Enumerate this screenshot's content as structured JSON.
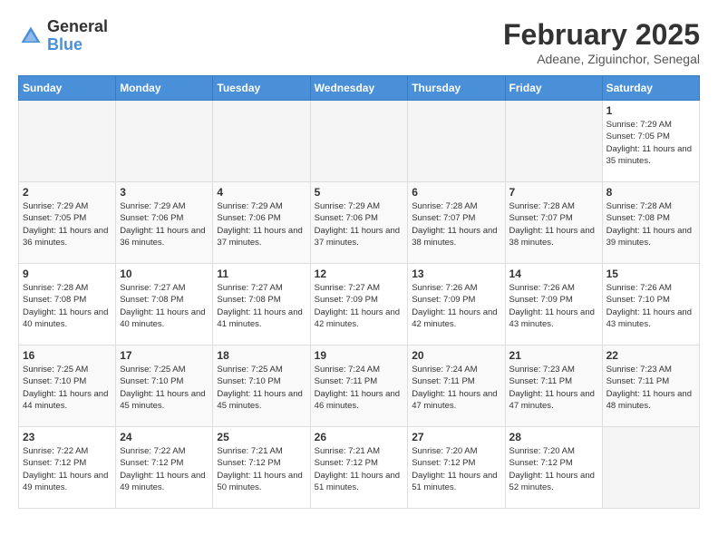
{
  "header": {
    "logo_general": "General",
    "logo_blue": "Blue",
    "month_title": "February 2025",
    "location": "Adeane, Ziguinchor, Senegal"
  },
  "weekdays": [
    "Sunday",
    "Monday",
    "Tuesday",
    "Wednesday",
    "Thursday",
    "Friday",
    "Saturday"
  ],
  "weeks": [
    [
      {
        "day": "",
        "info": ""
      },
      {
        "day": "",
        "info": ""
      },
      {
        "day": "",
        "info": ""
      },
      {
        "day": "",
        "info": ""
      },
      {
        "day": "",
        "info": ""
      },
      {
        "day": "",
        "info": ""
      },
      {
        "day": "1",
        "info": "Sunrise: 7:29 AM\nSunset: 7:05 PM\nDaylight: 11 hours and 35 minutes."
      }
    ],
    [
      {
        "day": "2",
        "info": "Sunrise: 7:29 AM\nSunset: 7:05 PM\nDaylight: 11 hours and 36 minutes."
      },
      {
        "day": "3",
        "info": "Sunrise: 7:29 AM\nSunset: 7:06 PM\nDaylight: 11 hours and 36 minutes."
      },
      {
        "day": "4",
        "info": "Sunrise: 7:29 AM\nSunset: 7:06 PM\nDaylight: 11 hours and 37 minutes."
      },
      {
        "day": "5",
        "info": "Sunrise: 7:29 AM\nSunset: 7:06 PM\nDaylight: 11 hours and 37 minutes."
      },
      {
        "day": "6",
        "info": "Sunrise: 7:28 AM\nSunset: 7:07 PM\nDaylight: 11 hours and 38 minutes."
      },
      {
        "day": "7",
        "info": "Sunrise: 7:28 AM\nSunset: 7:07 PM\nDaylight: 11 hours and 38 minutes."
      },
      {
        "day": "8",
        "info": "Sunrise: 7:28 AM\nSunset: 7:08 PM\nDaylight: 11 hours and 39 minutes."
      }
    ],
    [
      {
        "day": "9",
        "info": "Sunrise: 7:28 AM\nSunset: 7:08 PM\nDaylight: 11 hours and 40 minutes."
      },
      {
        "day": "10",
        "info": "Sunrise: 7:27 AM\nSunset: 7:08 PM\nDaylight: 11 hours and 40 minutes."
      },
      {
        "day": "11",
        "info": "Sunrise: 7:27 AM\nSunset: 7:08 PM\nDaylight: 11 hours and 41 minutes."
      },
      {
        "day": "12",
        "info": "Sunrise: 7:27 AM\nSunset: 7:09 PM\nDaylight: 11 hours and 42 minutes."
      },
      {
        "day": "13",
        "info": "Sunrise: 7:26 AM\nSunset: 7:09 PM\nDaylight: 11 hours and 42 minutes."
      },
      {
        "day": "14",
        "info": "Sunrise: 7:26 AM\nSunset: 7:09 PM\nDaylight: 11 hours and 43 minutes."
      },
      {
        "day": "15",
        "info": "Sunrise: 7:26 AM\nSunset: 7:10 PM\nDaylight: 11 hours and 43 minutes."
      }
    ],
    [
      {
        "day": "16",
        "info": "Sunrise: 7:25 AM\nSunset: 7:10 PM\nDaylight: 11 hours and 44 minutes."
      },
      {
        "day": "17",
        "info": "Sunrise: 7:25 AM\nSunset: 7:10 PM\nDaylight: 11 hours and 45 minutes."
      },
      {
        "day": "18",
        "info": "Sunrise: 7:25 AM\nSunset: 7:10 PM\nDaylight: 11 hours and 45 minutes."
      },
      {
        "day": "19",
        "info": "Sunrise: 7:24 AM\nSunset: 7:11 PM\nDaylight: 11 hours and 46 minutes."
      },
      {
        "day": "20",
        "info": "Sunrise: 7:24 AM\nSunset: 7:11 PM\nDaylight: 11 hours and 47 minutes."
      },
      {
        "day": "21",
        "info": "Sunrise: 7:23 AM\nSunset: 7:11 PM\nDaylight: 11 hours and 47 minutes."
      },
      {
        "day": "22",
        "info": "Sunrise: 7:23 AM\nSunset: 7:11 PM\nDaylight: 11 hours and 48 minutes."
      }
    ],
    [
      {
        "day": "23",
        "info": "Sunrise: 7:22 AM\nSunset: 7:12 PM\nDaylight: 11 hours and 49 minutes."
      },
      {
        "day": "24",
        "info": "Sunrise: 7:22 AM\nSunset: 7:12 PM\nDaylight: 11 hours and 49 minutes."
      },
      {
        "day": "25",
        "info": "Sunrise: 7:21 AM\nSunset: 7:12 PM\nDaylight: 11 hours and 50 minutes."
      },
      {
        "day": "26",
        "info": "Sunrise: 7:21 AM\nSunset: 7:12 PM\nDaylight: 11 hours and 51 minutes."
      },
      {
        "day": "27",
        "info": "Sunrise: 7:20 AM\nSunset: 7:12 PM\nDaylight: 11 hours and 51 minutes."
      },
      {
        "day": "28",
        "info": "Sunrise: 7:20 AM\nSunset: 7:12 PM\nDaylight: 11 hours and 52 minutes."
      },
      {
        "day": "",
        "info": ""
      }
    ]
  ]
}
